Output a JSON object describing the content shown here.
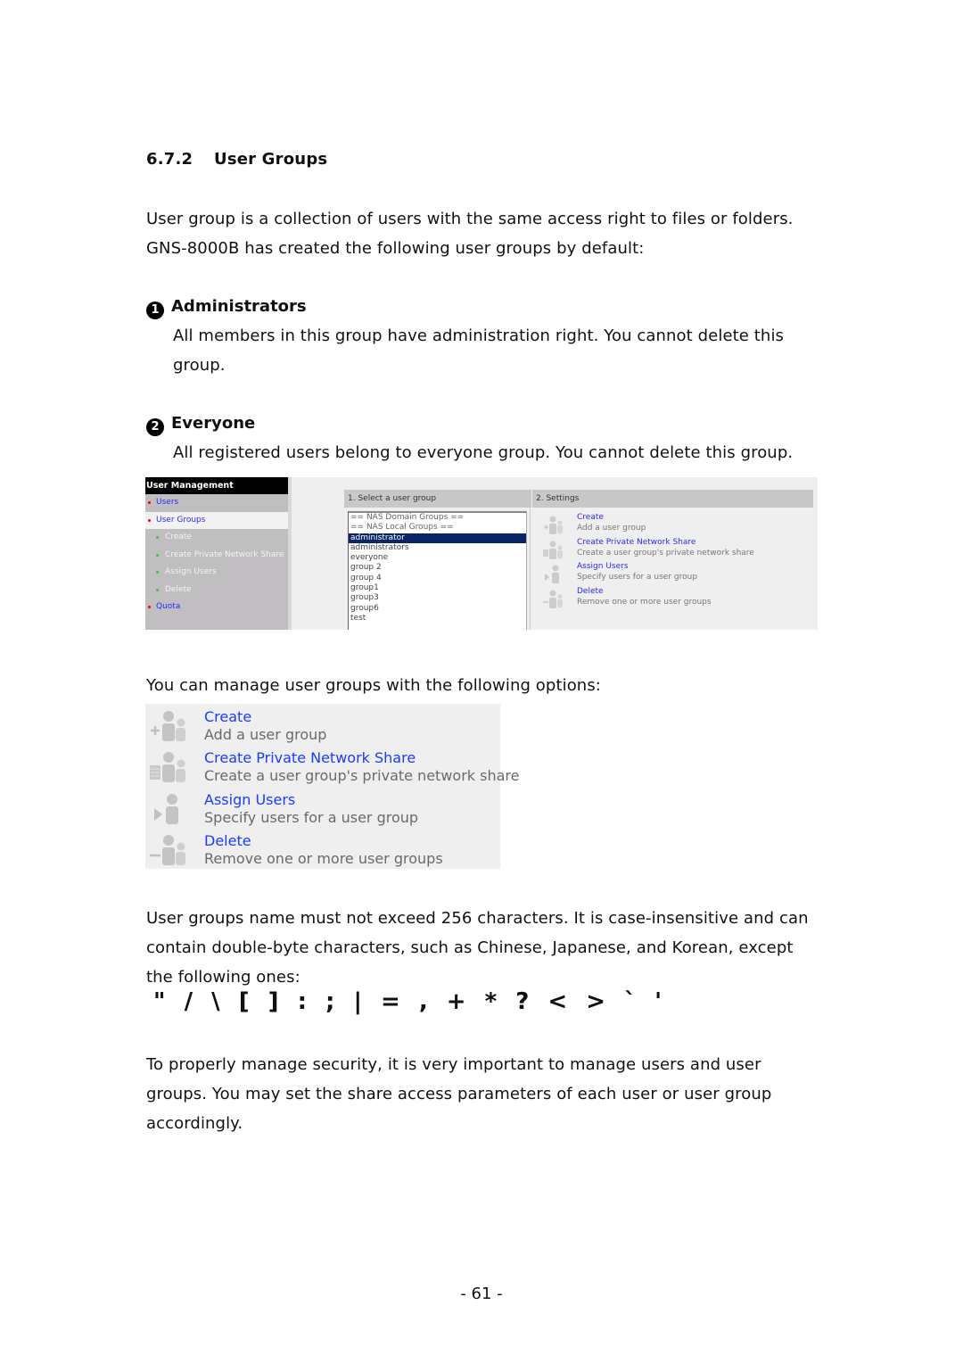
{
  "section": {
    "number": "6.7.2",
    "title": "User Groups"
  },
  "intro": {
    "line1": "User group is a collection of users with the same access right to files or folders.",
    "line2": "GNS-8000B has created the following user groups by default:"
  },
  "default_groups": [
    {
      "marker": "1",
      "name": "Administrators",
      "desc_line1": "All members in this group have administration right.  You cannot delete this",
      "desc_line2": "group."
    },
    {
      "marker": "2",
      "name": "Everyone",
      "desc_line1": "All registered users belong to everyone group.  You cannot delete this group."
    }
  ],
  "screenshot_user_management": {
    "nav_title": "User Management",
    "nav_items": [
      {
        "label": "Users",
        "level": 1
      },
      {
        "label": "User Groups",
        "level": 1,
        "active": true
      },
      {
        "label": "Create",
        "level": 2
      },
      {
        "label": "Create Private Network Share",
        "level": 2
      },
      {
        "label": "Assign Users",
        "level": 2
      },
      {
        "label": "Delete",
        "level": 2
      },
      {
        "label": "Quota",
        "level": 1
      }
    ],
    "panel1_header": "1. Select a user group",
    "panel2_header": "2. Settings",
    "group_list": [
      "== NAS Domain Groups ==",
      "== NAS Local Groups ==",
      "administrator",
      "administrators",
      "everyone",
      "group 2",
      "group 4",
      "group1",
      "group3",
      "group6",
      "test"
    ],
    "selected_group": "administrator",
    "settings": [
      {
        "title": "Create",
        "desc": "Add a user group",
        "icon": "add-group-icon"
      },
      {
        "title": "Create Private Network Share",
        "desc": "Create a user group's private network share",
        "icon": "share-group-icon"
      },
      {
        "title": "Assign Users",
        "desc": "Specify users for a user group",
        "icon": "assign-user-icon"
      },
      {
        "title": "Delete",
        "desc": "Remove one or more user groups",
        "icon": "delete-group-icon"
      }
    ]
  },
  "options_intro": "You can manage user groups with the following options:",
  "options": [
    {
      "title": "Create",
      "desc": "Add a user group",
      "icon": "add-group-icon"
    },
    {
      "title": "Create Private Network Share",
      "desc": "Create a user group's private network share",
      "icon": "share-group-icon"
    },
    {
      "title": "Assign Users",
      "desc": "Specify users for a user group",
      "icon": "assign-user-icon"
    },
    {
      "title": "Delete",
      "desc": "Remove one or more user groups",
      "icon": "delete-group-icon"
    }
  ],
  "naming_rule": {
    "line1": "User groups name must not exceed 256 characters.  It is case-insensitive and can",
    "line2": "contain double-byte characters, such as Chinese, Japanese, and Korean, except",
    "line3": "the following ones:"
  },
  "forbidden_chars": "\" / \\ [ ] : ; | = , + * ? < > ` '",
  "closing": {
    "line1": "To properly manage security, it is very important to manage users and user",
    "line2": "groups.  You may set the share access parameters of each user or user group",
    "line3": "accordingly."
  },
  "page_number": "- 61 -",
  "colors": {
    "link_blue": "#1a3cff",
    "nav_bullet_red": "#ee0000",
    "sub_bullet_green": "#33cc33",
    "selection_navy": "#0a2466"
  }
}
